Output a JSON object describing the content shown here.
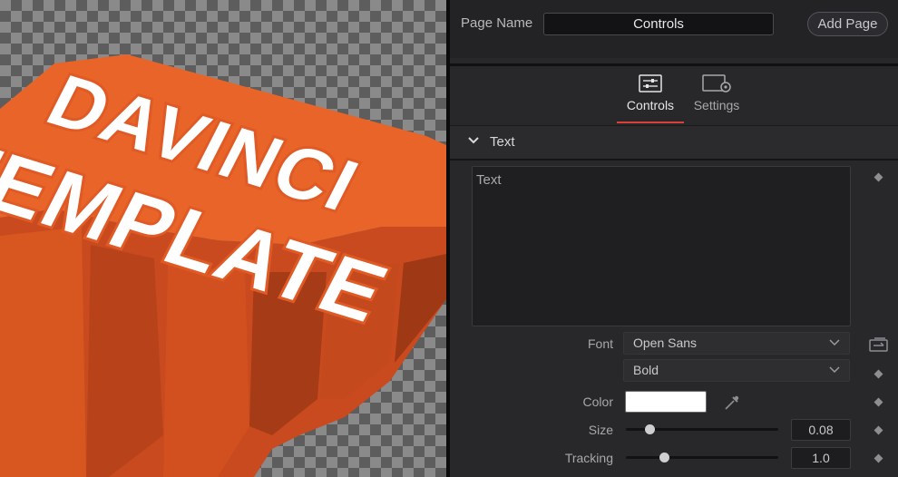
{
  "viewer": {
    "logo_line1": "DAVINCI",
    "logo_line2": "TEMPLATE",
    "accent_color": "#e05a26"
  },
  "page_bar": {
    "label": "Page Name",
    "value": "Controls",
    "add_page_label": "Add Page"
  },
  "tabs": [
    {
      "label": "Controls",
      "icon": "sliders-icon",
      "active": true
    },
    {
      "label": "Settings",
      "icon": "settings-gear-icon",
      "active": false
    }
  ],
  "section": {
    "title": "Text",
    "text_value": "Text"
  },
  "font": {
    "label": "Font",
    "family": "Open Sans",
    "style": "Bold"
  },
  "color": {
    "label": "Color",
    "value": "#ffffff"
  },
  "size": {
    "label": "Size",
    "value": "0.08",
    "fraction": 0.16
  },
  "tracking": {
    "label": "Tracking",
    "value": "1.0",
    "fraction": 0.25
  },
  "colors": {
    "tab_underline": "#d8413a",
    "panel_bg": "#28282b"
  }
}
